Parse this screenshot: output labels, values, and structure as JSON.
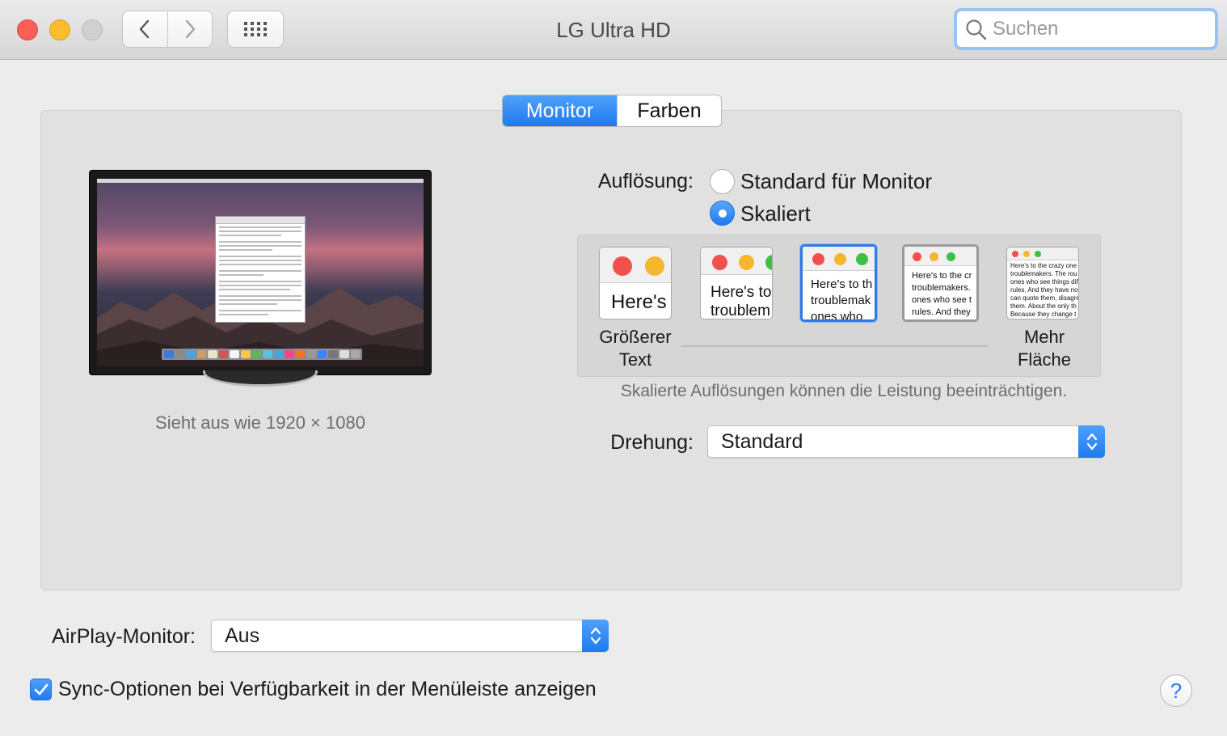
{
  "window": {
    "title": "LG Ultra HD",
    "search_placeholder": "Suchen"
  },
  "tabs": [
    {
      "label": "Monitor",
      "active": true
    },
    {
      "label": "Farben",
      "active": false
    }
  ],
  "monitor_preview": {
    "looks_like": "Sieht aus wie 1920 × 1080"
  },
  "resolution": {
    "label": "Auflösung:",
    "options": [
      {
        "label": "Standard für Monitor",
        "selected": false
      },
      {
        "label": "Skaliert",
        "selected": true
      }
    ],
    "scale_options": [
      {
        "text_lines": [
          "Here's"
        ]
      },
      {
        "text_lines": [
          "Here's to",
          "troublem"
        ]
      },
      {
        "text_lines": [
          "Here's to th",
          "troublemak",
          "ones who"
        ],
        "selected": true
      },
      {
        "text_lines": [
          "Here's to the cr",
          "troublemakers.",
          "ones who see t",
          "rules. And they"
        ]
      },
      {
        "text_lines": [
          "Here's to the crazy one",
          "troublemakers. The rou",
          "ones who see things dif",
          "rules. And they have no",
          "can quote them, disagre",
          "them. About the only th",
          "Because they change t"
        ]
      }
    ],
    "larger_text_label": "Größerer Text",
    "larger_text_lines": [
      "Größerer",
      "Text"
    ],
    "more_space_lines": [
      "Mehr",
      "Fläche"
    ],
    "performance_note": "Skalierte Auflösungen können die Leistung beeinträchtigen."
  },
  "rotation": {
    "label": "Drehung:",
    "value": "Standard"
  },
  "airplay": {
    "label": "AirPlay-Monitor:",
    "value": "Aus"
  },
  "sync_option": {
    "label": "Sync-Optionen bei Verfügbarkeit in der Menüleiste anzeigen",
    "checked": true
  },
  "help": {
    "label": "?"
  },
  "colors": {
    "accent": "#1f7bf0",
    "close": "#fc5f57",
    "minimize": "#fdbc2e",
    "zoom_disabled": "#d0d0d0"
  },
  "icons": [
    "back-chevron-icon",
    "forward-chevron-icon",
    "grid-icon",
    "search-icon",
    "stepper-icon",
    "checkmark-icon"
  ]
}
